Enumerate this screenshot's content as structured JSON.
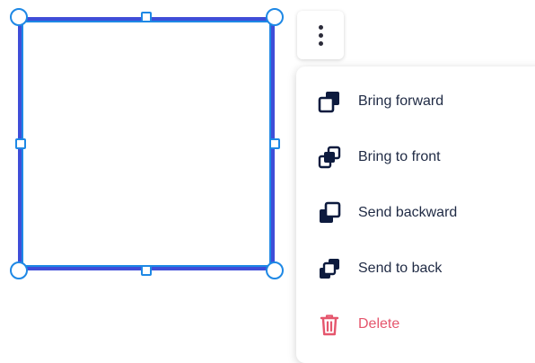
{
  "menu": {
    "items": [
      {
        "label": "Bring forward",
        "icon": "bring-forward-icon"
      },
      {
        "label": "Bring to front",
        "icon": "bring-to-front-icon"
      },
      {
        "label": "Send backward",
        "icon": "send-backward-icon"
      },
      {
        "label": "Send to back",
        "icon": "send-to-back-icon"
      },
      {
        "label": "Delete",
        "icon": "trash-icon"
      }
    ]
  },
  "more_button": {
    "icon": "vertical-dots-icon"
  },
  "colors": {
    "selection": "#1e88e5",
    "shape_border": "#3f4dd8",
    "icon_dark": "#0d1b3e",
    "danger": "#e5566d",
    "text": "#1f2a44"
  }
}
